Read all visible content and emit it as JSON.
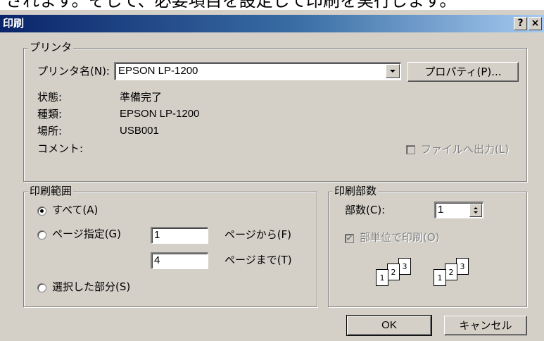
{
  "top_text": "されます。そして、必要項目を設定して印刷を実行します。",
  "dialog": {
    "title": "印刷",
    "help_button": "?",
    "close_button": "×"
  },
  "printer": {
    "group_label": "プリンタ",
    "name_label": "プリンタ名(N):",
    "name_value": "EPSON LP-1200",
    "properties_button": "プロパティ(P)...",
    "status_label": "状態:",
    "status_value": "準備完了",
    "type_label": "種類:",
    "type_value": "EPSON LP-1200",
    "location_label": "場所:",
    "location_value": "USB001",
    "comment_label": "コメント:",
    "print_to_file_label": "ファイルへ出力(L)"
  },
  "range": {
    "group_label": "印刷範囲",
    "all_label": "すべて(A)",
    "pages_label": "ページ指定(G)",
    "from_value": "1",
    "from_label": "ページから(F)",
    "to_value": "4",
    "to_label": "ページまで(T)",
    "selection_label": "選択した部分(S)"
  },
  "copies": {
    "group_label": "印刷部数",
    "count_label": "部数(C):",
    "count_value": "1",
    "collate_label": "部単位で印刷(O)",
    "pages": [
      "1",
      "2",
      "3"
    ]
  },
  "buttons": {
    "ok": "OK",
    "cancel": "キャンセル"
  },
  "colors": {
    "title_start": "#0a246a",
    "title_end": "#a6caf0",
    "face": "#d4d0c8"
  }
}
